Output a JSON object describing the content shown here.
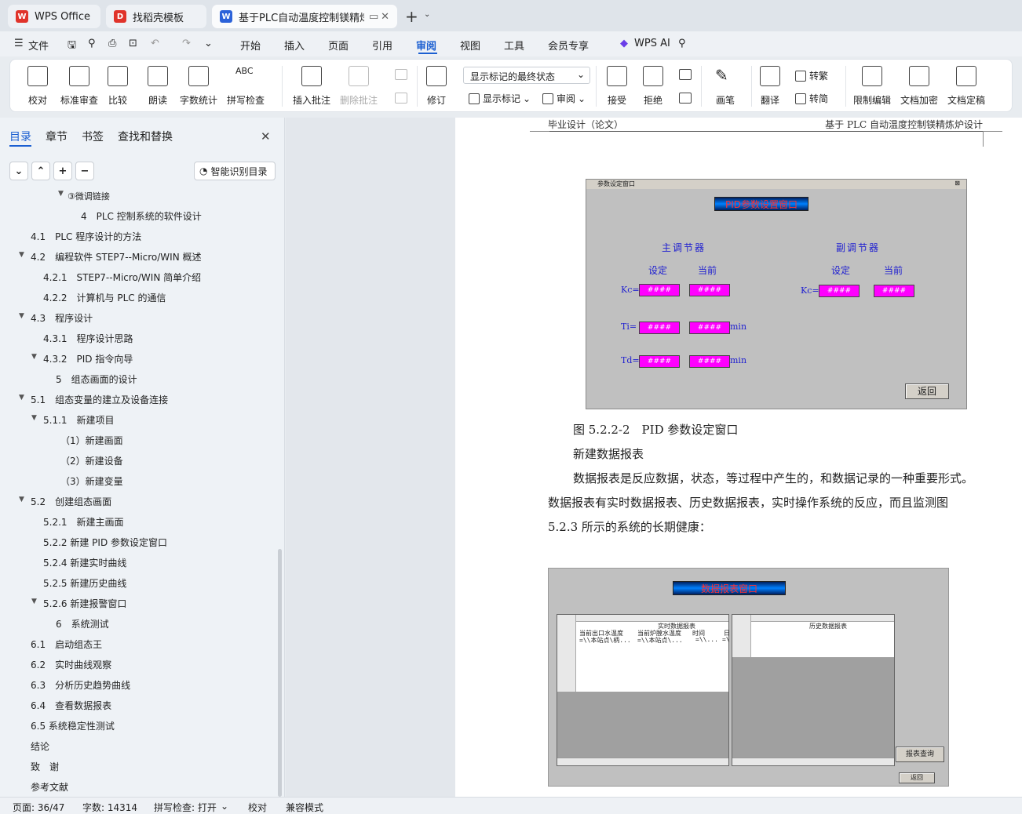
{
  "tabs": [
    {
      "label": "WPS Office"
    },
    {
      "label": "找稻壳模板"
    },
    {
      "label": "基于PLC自动温度控制镁精炼"
    }
  ],
  "menu": {
    "file": "文件",
    "items": [
      "开始",
      "插入",
      "页面",
      "引用",
      "审阅",
      "视图",
      "工具",
      "会员专享"
    ],
    "active": "审阅",
    "ai": "WPS AI"
  },
  "ribbon": {
    "proofread": "校对",
    "standard_review": "标准审查",
    "compare": "比较",
    "read_aloud": "朗读",
    "word_count": "字数统计",
    "spell_check": "拼写检查",
    "insert_comment": "插入批注",
    "delete_comment": "删除批注",
    "revise": "修订",
    "markup_select": "显示标记的最终状态",
    "show_markup": "显示标记",
    "review": "审阅",
    "accept": "接受",
    "reject": "拒绝",
    "pen": "画笔",
    "translate": "翻译",
    "to_traditional": "转繁",
    "to_simplified": "转简",
    "restrict_edit": "限制编辑",
    "doc_encrypt": "文档加密",
    "doc_finalize": "文档定稿"
  },
  "panel": {
    "tabs": [
      "目录",
      "章节",
      "书签",
      "查找和替换"
    ],
    "smart_btn": "智能识别目录",
    "toc": [
      "③微调链接",
      "4　PLC 控制系统的软件设计",
      "4.1　PLC 程序设计的方法",
      "4.2　编程软件 STEP7--Micro/WIN  概述",
      "4.2.1　STEP7--Micro/WIN  简单介绍",
      "4.2.2　计算机与 PLC 的通信",
      "4.3　程序设计",
      "4.3.1　程序设计思路",
      "4.3.2　PID 指令向导",
      "5　组态画面的设计",
      "5.1　组态变量的建立及设备连接",
      "5.1.1　新建项目",
      "（1）新建画面",
      "（2）新建设备",
      "（3）新建变量",
      "5.2　创建组态画面",
      "5.2.1　新建主画面",
      "5.2.2  新建 PID 参数设定窗口",
      "5.2.4  新建实时曲线",
      "5.2.5  新建历史曲线",
      "5.2.6  新建报警窗口",
      "6　系统测试",
      "6.1　启动组态王",
      "6.2　实时曲线观察",
      "6.3　分析历史趋势曲线",
      "6.4　查看数据报表",
      "6.5  系统稳定性测试",
      "结论",
      "致　谢",
      "参考文献"
    ]
  },
  "doc": {
    "header_left": "毕业设计（论文）",
    "header_right": "基于 PLC 自动温度控制镁精炼炉设计",
    "fig1": {
      "window_title": "参数设定窗口",
      "banner": "PID参数设置窗口",
      "main_ctrl": "主调节器",
      "sub_ctrl": "副调节器",
      "set": "设定",
      "current": "当前",
      "kc": "Kc=",
      "ti": "Ti=",
      "td": "Td=",
      "hash": "####",
      "min": "min",
      "back": "返回"
    },
    "caption": "图 5.2.2-2　PID 参数设定窗口",
    "subheading": "新建数据报表",
    "para1": "数据报表是反应数据，状态，等过程中产生的，和数据记录的一种重要形式。",
    "para2": "数据报表有实时数据报表、历史数据报表，实时操作系统的反应，而且监测图",
    "para3": "5.2.3 所示的系统的长期健康：",
    "fig2": {
      "banner": "数据报表窗口",
      "realtime_title": "实时数据报表",
      "history_title": "历史数据报表",
      "col_outlet": "当前出口水温度",
      "col_furnace": "当前炉膛水温度",
      "col_time": "时间",
      "col_day": "日",
      "val_outlet": "=\\\\本站点\\柄...",
      "val_furnace": "=\\\\本站点\\...",
      "val_time": "=\\\\...",
      "val_day": "=\\",
      "query_btn": "报表查询",
      "back": "返回"
    }
  },
  "status": {
    "page": "页面: 36/47",
    "words": "字数: 14314",
    "spell": "拼写检查: 打开",
    "proof": "校对",
    "compat": "兼容模式"
  }
}
